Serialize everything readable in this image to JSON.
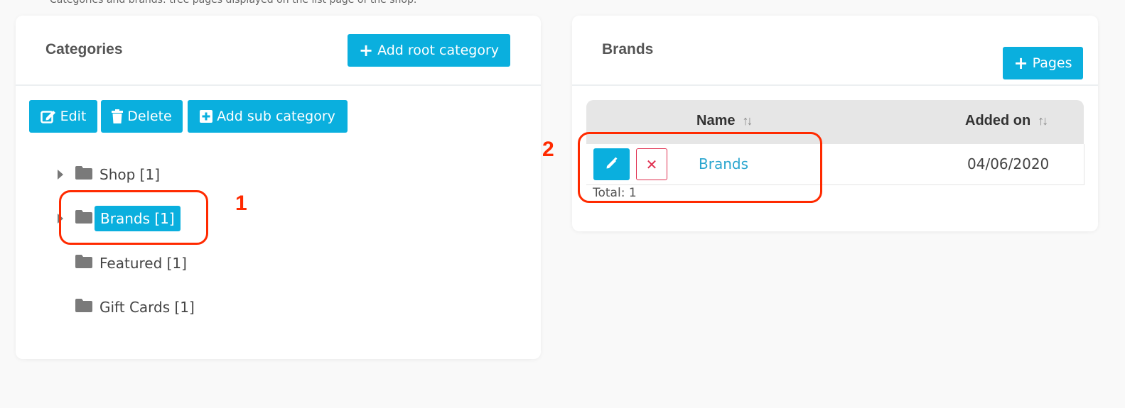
{
  "top_text": "Categories and brands: tree pages displayed on the list page of the shop.",
  "categories_panel": {
    "title": "Categories",
    "add_root_label": "Add root category",
    "edit_label": "Edit",
    "delete_label": "Delete",
    "add_sub_label": "Add sub category",
    "tree": [
      {
        "label": "Shop [1]",
        "expandable": true,
        "selected": false
      },
      {
        "label": "Brands [1]",
        "expandable": true,
        "selected": true
      },
      {
        "label": "Featured [1]",
        "expandable": false,
        "selected": false
      },
      {
        "label": "Gift Cards [1]",
        "expandable": false,
        "selected": false
      }
    ]
  },
  "brands_panel": {
    "title": "Brands",
    "pages_button_label": "Pages",
    "columns": [
      "Name",
      "Added on"
    ],
    "rows": [
      {
        "name": "Brands",
        "added_on": "04/06/2020"
      }
    ],
    "total": "Total: 1"
  },
  "annotations": [
    "1",
    "2"
  ],
  "colors": {
    "accent": "#0aafde",
    "danger": "#e03050",
    "annotation": "#ff2a00"
  }
}
